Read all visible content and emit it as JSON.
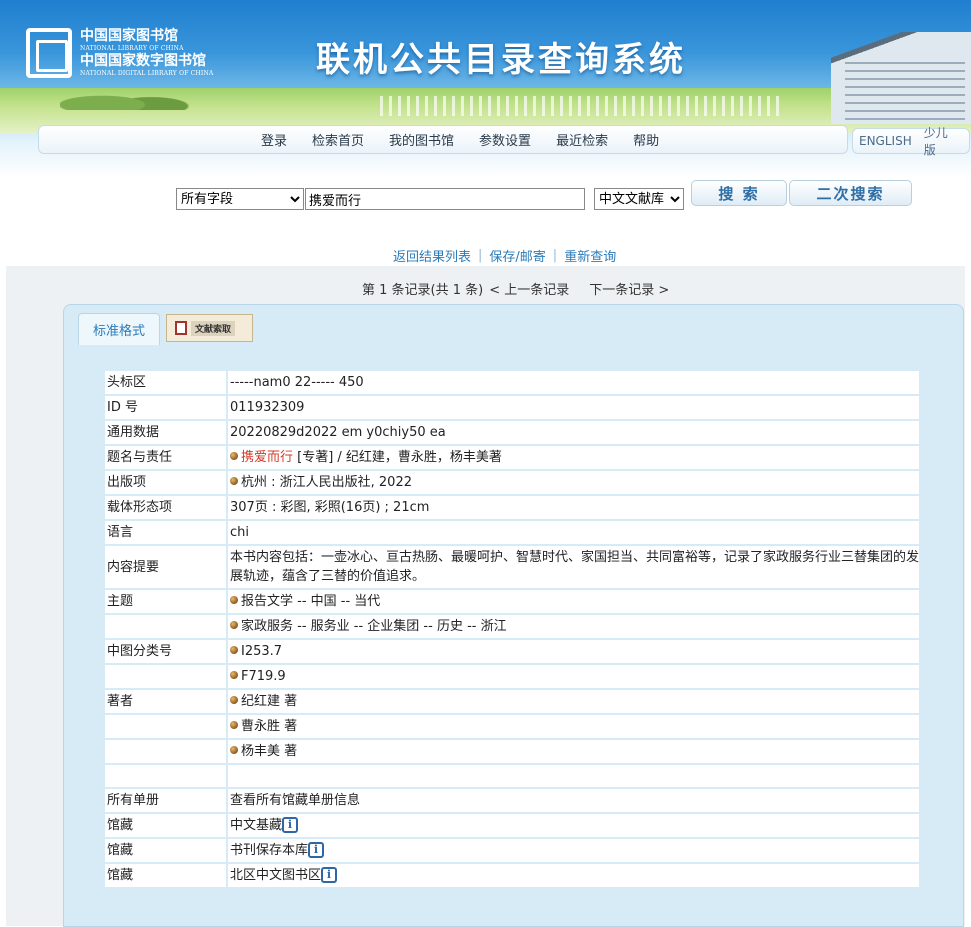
{
  "header": {
    "logo_cn_line1": "中国国家图书馆",
    "logo_en_line1": "NATIONAL LIBRARY OF CHINA",
    "logo_cn_line2": "中国国家数字图书馆",
    "logo_en_line2": "NATIONAL DIGITAL LIBRARY OF CHINA",
    "site_title": "联机公共目录查询系统",
    "nav": [
      "登录",
      "检索首页",
      "我的图书馆",
      "参数设置",
      "最近检索",
      "帮助"
    ],
    "lang": [
      "ENGLISH",
      "少儿版"
    ]
  },
  "search": {
    "field_selected": "所有字段",
    "query": "携爱而行",
    "db_selected": "中文文献库",
    "search_button": "搜 索",
    "secondary_button": "二次搜索"
  },
  "result_links": [
    "返回结果列表",
    "保存/邮寄",
    "重新查询"
  ],
  "record_nav": {
    "summary": "第 1 条记录(共 1 条)",
    "prev": "< 上一条记录",
    "next": "下一条记录 >"
  },
  "tabs": {
    "standard": "标准格式",
    "doc_fetch": "文献索取"
  },
  "record": {
    "rows": [
      {
        "label": "头标区",
        "value": "-----nam0 22----- 450"
      },
      {
        "label": "ID 号",
        "value": "011932309"
      },
      {
        "label": "通用数据",
        "value": "20220829d2022 em y0chiy50 ea"
      },
      {
        "label": "题名与责任",
        "title_link": "携爱而行",
        "value": " [专著] / 纪红建，曹永胜，杨丰美著"
      },
      {
        "label": "出版项",
        "value": "杭州 : 浙江人民出版社, 2022"
      },
      {
        "label": "载体形态项",
        "value": "307页 : 彩图, 彩照(16页) ; 21cm"
      },
      {
        "label": "语言",
        "value": "chi"
      },
      {
        "label": "内容提要",
        "value": "本书内容包括：一壶冰心、亘古热肠、最暖呵护、智慧时代、家国担当、共同富裕等，记录了家政服务行业三替集团的发展轨迹，蕴含了三替的价值追求。"
      },
      {
        "label": "主题",
        "value": "报告文学 -- 中国 -- 当代"
      },
      {
        "label": "",
        "value": "家政服务 -- 服务业 -- 企业集团 -- 历史 -- 浙江"
      },
      {
        "label": "中图分类号",
        "value": "I253.7"
      },
      {
        "label": "",
        "value": "F719.9"
      },
      {
        "label": "著者",
        "value": "纪红建 著"
      },
      {
        "label": "",
        "value": "曹永胜 著"
      },
      {
        "label": "",
        "value": "杨丰美 著"
      },
      {
        "label": "",
        "value": ""
      },
      {
        "label": "所有单册",
        "value": "查看所有馆藏单册信息"
      },
      {
        "label": "馆藏",
        "value": "中文基藏"
      },
      {
        "label": "馆藏",
        "value": "书刊保存本库"
      },
      {
        "label": "馆藏",
        "value": "北区中文图书区"
      }
    ]
  },
  "icons": {
    "bullet": "bullet-icon",
    "info": "info-icon",
    "info_glyph": "i"
  },
  "colors": {
    "link_blue": "#2b7bb9",
    "title_red": "#d33a2a",
    "panel_bg": "#d6ebf5"
  }
}
